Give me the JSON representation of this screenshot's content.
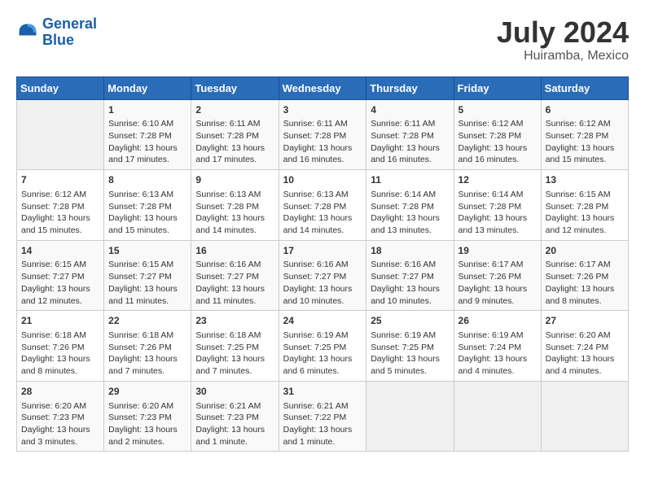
{
  "header": {
    "logo_line1": "General",
    "logo_line2": "Blue",
    "month_year": "July 2024",
    "location": "Huiramba, Mexico"
  },
  "days_of_week": [
    "Sunday",
    "Monday",
    "Tuesday",
    "Wednesday",
    "Thursday",
    "Friday",
    "Saturday"
  ],
  "weeks": [
    [
      {
        "day": "",
        "info": ""
      },
      {
        "day": "1",
        "info": "Sunrise: 6:10 AM\nSunset: 7:28 PM\nDaylight: 13 hours\nand 17 minutes."
      },
      {
        "day": "2",
        "info": "Sunrise: 6:11 AM\nSunset: 7:28 PM\nDaylight: 13 hours\nand 17 minutes."
      },
      {
        "day": "3",
        "info": "Sunrise: 6:11 AM\nSunset: 7:28 PM\nDaylight: 13 hours\nand 16 minutes."
      },
      {
        "day": "4",
        "info": "Sunrise: 6:11 AM\nSunset: 7:28 PM\nDaylight: 13 hours\nand 16 minutes."
      },
      {
        "day": "5",
        "info": "Sunrise: 6:12 AM\nSunset: 7:28 PM\nDaylight: 13 hours\nand 16 minutes."
      },
      {
        "day": "6",
        "info": "Sunrise: 6:12 AM\nSunset: 7:28 PM\nDaylight: 13 hours\nand 15 minutes."
      }
    ],
    [
      {
        "day": "7",
        "info": "Sunrise: 6:12 AM\nSunset: 7:28 PM\nDaylight: 13 hours\nand 15 minutes."
      },
      {
        "day": "8",
        "info": "Sunrise: 6:13 AM\nSunset: 7:28 PM\nDaylight: 13 hours\nand 15 minutes."
      },
      {
        "day": "9",
        "info": "Sunrise: 6:13 AM\nSunset: 7:28 PM\nDaylight: 13 hours\nand 14 minutes."
      },
      {
        "day": "10",
        "info": "Sunrise: 6:13 AM\nSunset: 7:28 PM\nDaylight: 13 hours\nand 14 minutes."
      },
      {
        "day": "11",
        "info": "Sunrise: 6:14 AM\nSunset: 7:28 PM\nDaylight: 13 hours\nand 13 minutes."
      },
      {
        "day": "12",
        "info": "Sunrise: 6:14 AM\nSunset: 7:28 PM\nDaylight: 13 hours\nand 13 minutes."
      },
      {
        "day": "13",
        "info": "Sunrise: 6:15 AM\nSunset: 7:28 PM\nDaylight: 13 hours\nand 12 minutes."
      }
    ],
    [
      {
        "day": "14",
        "info": "Sunrise: 6:15 AM\nSunset: 7:27 PM\nDaylight: 13 hours\nand 12 minutes."
      },
      {
        "day": "15",
        "info": "Sunrise: 6:15 AM\nSunset: 7:27 PM\nDaylight: 13 hours\nand 11 minutes."
      },
      {
        "day": "16",
        "info": "Sunrise: 6:16 AM\nSunset: 7:27 PM\nDaylight: 13 hours\nand 11 minutes."
      },
      {
        "day": "17",
        "info": "Sunrise: 6:16 AM\nSunset: 7:27 PM\nDaylight: 13 hours\nand 10 minutes."
      },
      {
        "day": "18",
        "info": "Sunrise: 6:16 AM\nSunset: 7:27 PM\nDaylight: 13 hours\nand 10 minutes."
      },
      {
        "day": "19",
        "info": "Sunrise: 6:17 AM\nSunset: 7:26 PM\nDaylight: 13 hours\nand 9 minutes."
      },
      {
        "day": "20",
        "info": "Sunrise: 6:17 AM\nSunset: 7:26 PM\nDaylight: 13 hours\nand 8 minutes."
      }
    ],
    [
      {
        "day": "21",
        "info": "Sunrise: 6:18 AM\nSunset: 7:26 PM\nDaylight: 13 hours\nand 8 minutes."
      },
      {
        "day": "22",
        "info": "Sunrise: 6:18 AM\nSunset: 7:26 PM\nDaylight: 13 hours\nand 7 minutes."
      },
      {
        "day": "23",
        "info": "Sunrise: 6:18 AM\nSunset: 7:25 PM\nDaylight: 13 hours\nand 7 minutes."
      },
      {
        "day": "24",
        "info": "Sunrise: 6:19 AM\nSunset: 7:25 PM\nDaylight: 13 hours\nand 6 minutes."
      },
      {
        "day": "25",
        "info": "Sunrise: 6:19 AM\nSunset: 7:25 PM\nDaylight: 13 hours\nand 5 minutes."
      },
      {
        "day": "26",
        "info": "Sunrise: 6:19 AM\nSunset: 7:24 PM\nDaylight: 13 hours\nand 4 minutes."
      },
      {
        "day": "27",
        "info": "Sunrise: 6:20 AM\nSunset: 7:24 PM\nDaylight: 13 hours\nand 4 minutes."
      }
    ],
    [
      {
        "day": "28",
        "info": "Sunrise: 6:20 AM\nSunset: 7:23 PM\nDaylight: 13 hours\nand 3 minutes."
      },
      {
        "day": "29",
        "info": "Sunrise: 6:20 AM\nSunset: 7:23 PM\nDaylight: 13 hours\nand 2 minutes."
      },
      {
        "day": "30",
        "info": "Sunrise: 6:21 AM\nSunset: 7:23 PM\nDaylight: 13 hours\nand 1 minute."
      },
      {
        "day": "31",
        "info": "Sunrise: 6:21 AM\nSunset: 7:22 PM\nDaylight: 13 hours\nand 1 minute."
      },
      {
        "day": "",
        "info": ""
      },
      {
        "day": "",
        "info": ""
      },
      {
        "day": "",
        "info": ""
      }
    ]
  ]
}
